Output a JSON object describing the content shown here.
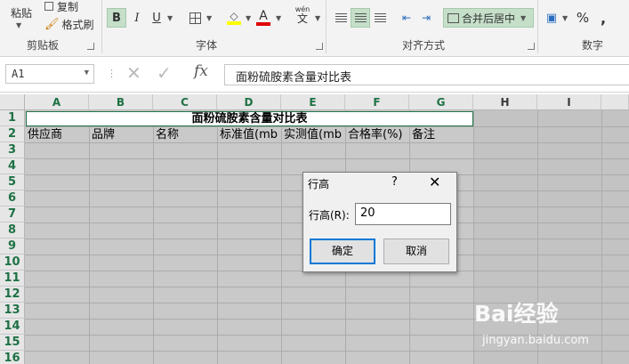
{
  "ribbon": {
    "clipboard": {
      "paste_label": "粘贴",
      "copy_label": "复制",
      "format_painter_label": "格式刷",
      "group_label": "剪贴板"
    },
    "font": {
      "bold": "B",
      "italic": "I",
      "underline": "U",
      "font_color_glyph": "A",
      "wen_label": "wén",
      "wen_char": "文",
      "group_label": "字体"
    },
    "alignment": {
      "merge_center_label": "合并后居中",
      "group_label": "对齐方式"
    },
    "number": {
      "percent": "%",
      "comma": ",",
      "group_label": "数字"
    }
  },
  "formula_bar": {
    "name_box": "A1",
    "fx": "fx",
    "formula_value": "面粉硫胺素含量对比表"
  },
  "sheet": {
    "column_headers": [
      "A",
      "B",
      "C",
      "D",
      "E",
      "F",
      "G",
      "H",
      "I"
    ],
    "row_headers": [
      "1",
      "2",
      "3",
      "4",
      "5",
      "6",
      "7",
      "8",
      "9",
      "10",
      "11",
      "12",
      "13",
      "14",
      "15",
      "16"
    ],
    "title": "面粉硫胺素含量对比表",
    "row2": [
      "供应商",
      "品牌",
      "名称",
      "标准值(mb",
      "实测值(mb",
      "合格率(%)",
      "备注"
    ]
  },
  "dialog": {
    "title": "行高",
    "help": "?",
    "field_label": "行高(R):",
    "field_value": "20",
    "ok_label": "确定",
    "cancel_label": "取消"
  },
  "watermark": {
    "brand": "Bai经验",
    "url": "jingyan.baidu.com"
  },
  "colors": {
    "accent": "#217346",
    "header_text": "#1e7145",
    "selected_button": "#c5dfc9",
    "dialog_default_border": "#0078d7"
  }
}
